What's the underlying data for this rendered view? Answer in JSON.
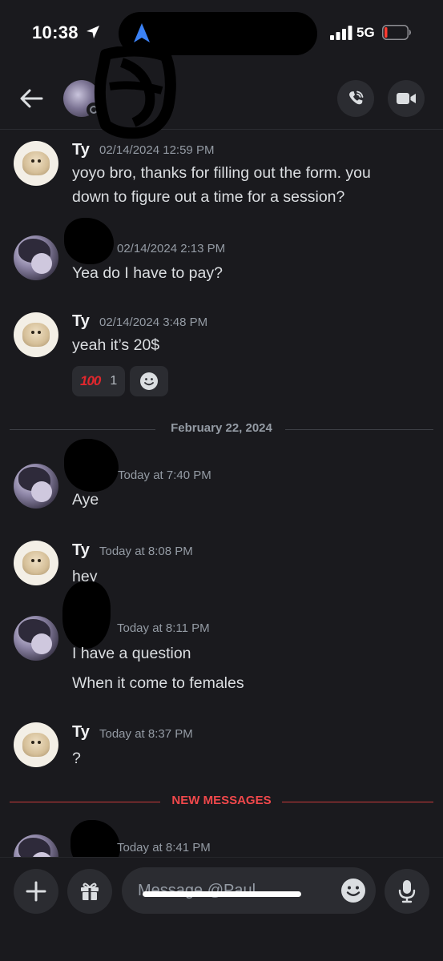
{
  "status_bar": {
    "time": "10:38",
    "network": "5G",
    "icons": [
      "location-arrow-icon",
      "navigation-arrow-icon",
      "signal-bars-icon",
      "battery-icon"
    ]
  },
  "header": {
    "icons": [
      "back-arrow-icon",
      "voice-call-icon",
      "video-call-icon"
    ]
  },
  "messages": [
    {
      "author": "Ty",
      "timestamp": "02/14/2024 12:59 PM",
      "lines": [
        "yoyo bro, thanks for filling out the form. you",
        "down to figure out a time for a session?"
      ]
    },
    {
      "author": "",
      "timestamp": "02/14/2024 2:13 PM",
      "lines": [
        "Yea do I have to pay?"
      ]
    },
    {
      "author": "Ty",
      "timestamp": "02/14/2024 3:48 PM",
      "lines": [
        "yeah it’s 20$"
      ],
      "reaction": {
        "emoji": "100",
        "count": "1"
      }
    },
    {
      "author": "",
      "timestamp": "Today at 7:40 PM",
      "lines": [
        "Aye"
      ]
    },
    {
      "author": "Ty",
      "timestamp": "Today at 8:08 PM",
      "lines": [
        "hey"
      ]
    },
    {
      "author": "",
      "timestamp": "Today at 8:11 PM",
      "lines": [
        "I have a question",
        "When it come to females"
      ]
    },
    {
      "author": "Ty",
      "timestamp": "Today at 8:37 PM",
      "lines": [
        "?"
      ]
    },
    {
      "author": "",
      "timestamp": "Today at 8:41 PM",
      "lines": []
    }
  ],
  "dividers": {
    "date": "February 22, 2024",
    "new_messages": "NEW MESSAGES"
  },
  "composer": {
    "placeholder": "Message @Paul",
    "icons": [
      "plus-icon",
      "gift-icon",
      "emoji-icon",
      "microphone-icon"
    ]
  },
  "colors": {
    "background": "#1a1a1e",
    "accent_blue": "#3b82f6",
    "new_messages_red": "#f0484b",
    "text_muted": "#949ba4"
  }
}
